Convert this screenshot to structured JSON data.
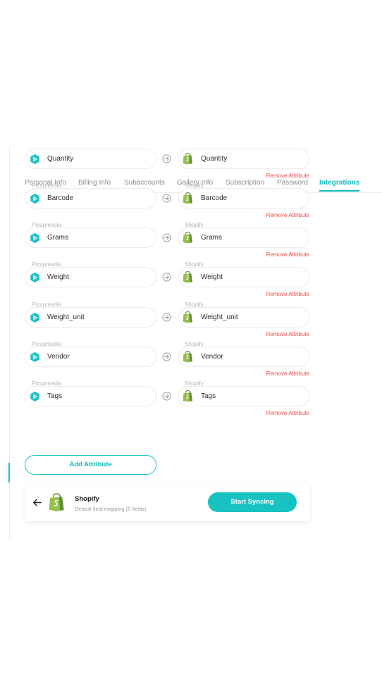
{
  "tabs": [
    {
      "label": "Personal Info",
      "active": false
    },
    {
      "label": "Billing Info",
      "active": false
    },
    {
      "label": "Subaccounts",
      "active": false
    },
    {
      "label": "Gallery Info",
      "active": false
    },
    {
      "label": "Subscription",
      "active": false
    },
    {
      "label": "Password",
      "active": false
    },
    {
      "label": "Integrations",
      "active": true
    }
  ],
  "mapping": {
    "source_label": "Picupmedia",
    "target_label": "Shopify",
    "remove_label": "Remove Attribute",
    "rows": [
      {
        "source": "Quantity",
        "target": "Quantity"
      },
      {
        "source": "Barcode",
        "target": "Barcode"
      },
      {
        "source": "Grams",
        "target": "Grams"
      },
      {
        "source": "Weight",
        "target": "Weight"
      },
      {
        "source": "Weight_unit",
        "target": "Weight_unit"
      },
      {
        "source": "Vendor",
        "target": "Vendor"
      },
      {
        "source": "Tags",
        "target": "Tags"
      }
    ]
  },
  "add_attribute_label": "Add Attribute",
  "footer": {
    "title": "Shopify",
    "subtitle": "Default field mapping (2 fields)",
    "sync_label": "Start Syncing"
  },
  "colors": {
    "accent": "#18c2c2",
    "remove": "#ee4a4a",
    "shopify_green": "#95bf47",
    "picupmedia": "#1fc0c6"
  }
}
